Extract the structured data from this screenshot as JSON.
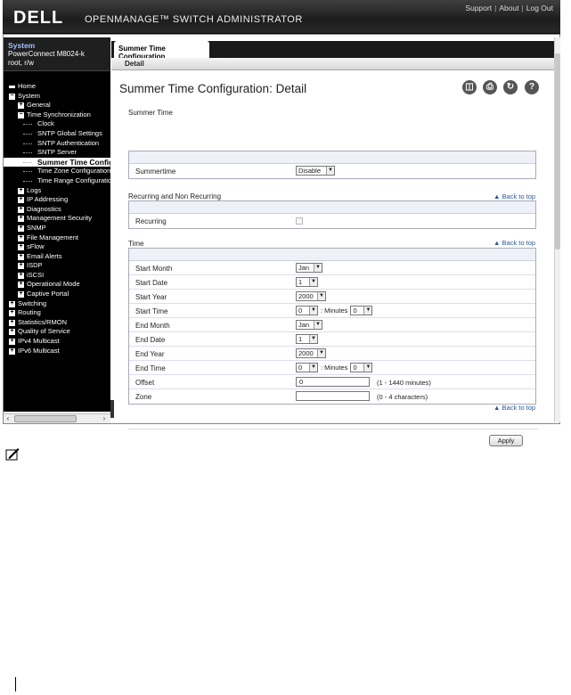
{
  "header": {
    "logo": "DELL",
    "app_title": "OPENMANAGE™ SWITCH ADMINISTRATOR",
    "links": [
      "Support",
      "About",
      "Log Out"
    ]
  },
  "nav": {
    "system_label": "System",
    "device": "PowerConnect M8024-k",
    "user": "root, r/w",
    "items": [
      {
        "label": "Home",
        "level": 0,
        "box": "line"
      },
      {
        "label": "System",
        "level": 0,
        "box": "−"
      },
      {
        "label": "General",
        "level": 1,
        "box": "+"
      },
      {
        "label": "Time Synchronization",
        "level": 1,
        "box": "−"
      },
      {
        "label": "Clock",
        "level": 2
      },
      {
        "label": "SNTP Global Settings",
        "level": 2
      },
      {
        "label": "SNTP Authentication",
        "level": 2
      },
      {
        "label": "SNTP Server",
        "level": 2
      },
      {
        "label": "Summer Time Configuration",
        "level": 2,
        "selected": true
      },
      {
        "label": "Time Zone Configuration",
        "level": 2
      },
      {
        "label": "Time Range Configuration",
        "level": 2
      },
      {
        "label": "Logs",
        "level": 1,
        "box": "+"
      },
      {
        "label": "IP Addressing",
        "level": 1,
        "box": "+"
      },
      {
        "label": "Diagnostics",
        "level": 1,
        "box": "+"
      },
      {
        "label": "Management Security",
        "level": 1,
        "box": "+"
      },
      {
        "label": "SNMP",
        "level": 1,
        "box": "+"
      },
      {
        "label": "File Management",
        "level": 1,
        "box": "+"
      },
      {
        "label": "sFlow",
        "level": 1,
        "box": "+"
      },
      {
        "label": "Email Alerts",
        "level": 1,
        "box": "+"
      },
      {
        "label": "ISDP",
        "level": 1,
        "box": "+"
      },
      {
        "label": "iSCSI",
        "level": 1,
        "box": "+"
      },
      {
        "label": "Operational Mode",
        "level": 1,
        "box": "+"
      },
      {
        "label": "Captive Portal",
        "level": 1,
        "box": "+"
      },
      {
        "label": "Switching",
        "level": 0,
        "box": "+"
      },
      {
        "label": "Routing",
        "level": 0,
        "box": "+"
      },
      {
        "label": "Statistics/RMON",
        "level": 0,
        "box": "+"
      },
      {
        "label": "Quality of Service",
        "level": 0,
        "box": "+"
      },
      {
        "label": "IPv4 Multicast",
        "level": 0,
        "box": "+"
      },
      {
        "label": "IPv6 Multicast",
        "level": 0,
        "box": "+"
      }
    ]
  },
  "tab": {
    "label": "Summer Time Configuration"
  },
  "subtab": {
    "label": "Detail"
  },
  "page": {
    "title": "Summer Time Configuration: Detail",
    "icons": [
      "save-icon",
      "print-icon",
      "refresh-icon",
      "help-icon"
    ]
  },
  "sections": {
    "summer_time": {
      "title": "Summer Time",
      "summertime_label": "Summertime",
      "summertime_value": "Disable"
    },
    "recurring": {
      "title": "Recurring and Non Recurring",
      "back_to_top": "Back to top",
      "recurring_label": "Recurring"
    },
    "time": {
      "title": "Time",
      "back_to_top": "Back to top",
      "start_month_label": "Start Month",
      "start_month": "Jan",
      "start_date_label": "Start Date",
      "start_date": "1",
      "start_year_label": "Start Year",
      "start_year": "2000",
      "start_time_label": "Start Time",
      "start_hour": "0",
      "start_min": "0",
      "end_month_label": "End Month",
      "end_month": "Jan",
      "end_date_label": "End Date",
      "end_date": "1",
      "end_year_label": "End Year",
      "end_year": "2000",
      "end_time_label": "End Time",
      "end_hour": "0",
      "end_min": "0",
      "minutes_label": ": Minutes",
      "offset_label": "Offset",
      "offset_value": "0",
      "offset_hint": "(1 - 1440 minutes)",
      "zone_label": "Zone",
      "zone_value": "",
      "zone_hint": "(0 - 4 characters)",
      "back_to_top_bottom": "Back to top"
    }
  },
  "apply_label": "Apply"
}
